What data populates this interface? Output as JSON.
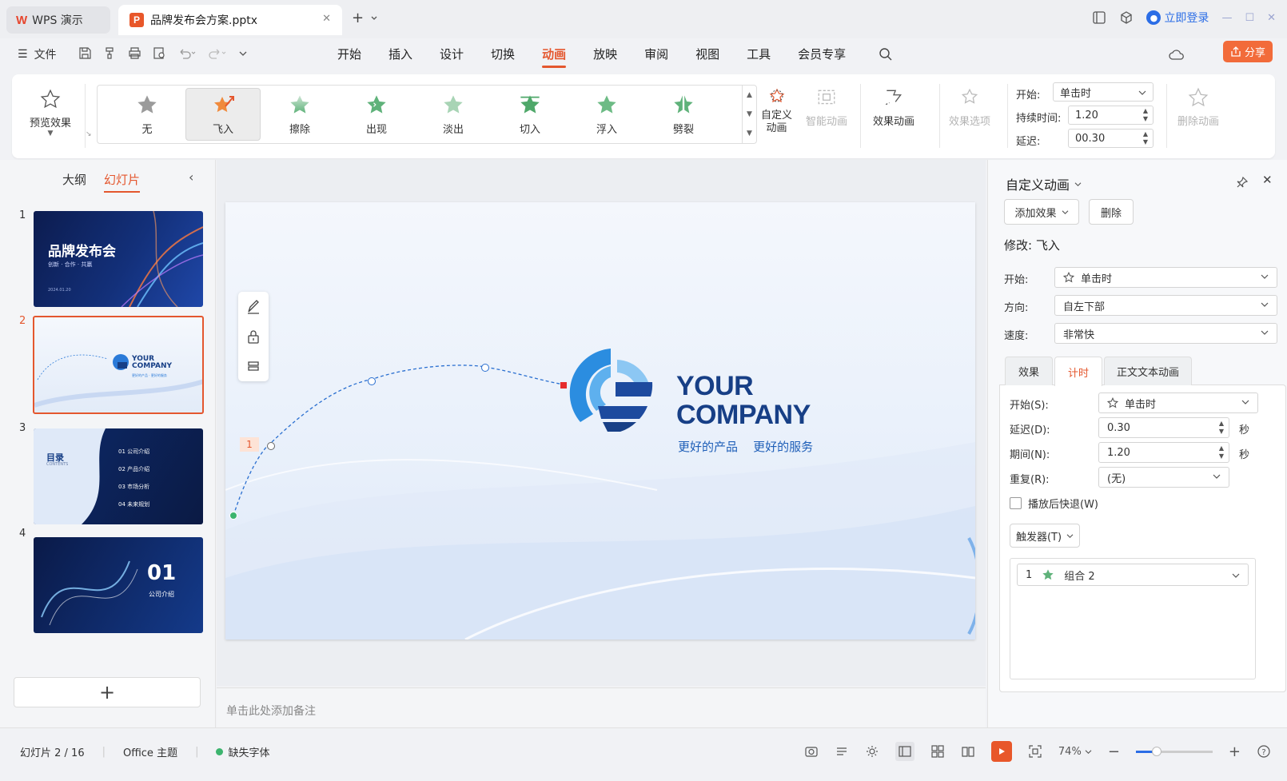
{
  "titlebar": {
    "app_name": "WPS 演示",
    "doc_tab": "品牌发布会方案.pptx",
    "login": "立即登录"
  },
  "menubar": {
    "file": "文件",
    "tabs": [
      "开始",
      "插入",
      "设计",
      "切换",
      "动画",
      "放映",
      "审阅",
      "视图",
      "工具",
      "会员专享"
    ],
    "active_tab": "动画",
    "share": "分享"
  },
  "ribbon": {
    "preview": "预览效果",
    "gallery": [
      "无",
      "飞入",
      "擦除",
      "出现",
      "淡出",
      "切入",
      "浮入",
      "劈裂"
    ],
    "selected_effect": "飞入",
    "custom_anim_line1": "自定义",
    "custom_anim_line2": "动画",
    "smart_anim": "智能动画",
    "path_anim": "效果动画",
    "effect_options": "效果选项",
    "start_label": "开始:",
    "start_value": "单击时",
    "duration_label": "持续时间:",
    "duration_value": "1.20",
    "delay_label": "延迟:",
    "delay_value": "00.30",
    "delete_anim": "删除动画"
  },
  "leftpanel": {
    "tab_outline": "大纲",
    "tab_slides": "幻灯片",
    "active_slide": 2,
    "slides": [
      {
        "num": "1",
        "title": "品牌发布会",
        "sub": "创新 · 合作 · 共赢",
        "date": "2024.01.20"
      },
      {
        "num": "2",
        "title": "YOUR",
        "title2": "COMPANY",
        "sub": "更好的产品 · 更好的服务"
      },
      {
        "num": "3",
        "title": "目录",
        "sub": "CONTENTS",
        "items": [
          "01  公司介绍",
          "02  产品介绍",
          "03  市场分析",
          "04  未来规划"
        ]
      },
      {
        "num": "4",
        "title": "01",
        "sub": "公司介绍"
      }
    ]
  },
  "slide": {
    "company_line1": "YOUR",
    "company_line2": "COMPANY",
    "tagline": "更好的产品    更好的服务",
    "anim_tag": "1"
  },
  "notes_placeholder": "单击此处添加备注",
  "rightpanel": {
    "title": "自定义动画",
    "add_effect": "添加效果",
    "delete": "删除",
    "modify": "修改: 飞入",
    "start_label": "开始:",
    "start_value": "单击时",
    "direction_label": "方向:",
    "direction_value": "自左下部",
    "speed_label": "速度:",
    "speed_value": "非常快",
    "tabs": [
      "效果",
      "计时",
      "正文文本动画"
    ],
    "active_tab": "计时",
    "t_start_label": "开始(S):",
    "t_start_value": "单击时",
    "t_delay_label": "延迟(D):",
    "t_delay_value": "0.30",
    "t_delay_unit": "秒",
    "t_period_label": "期间(N):",
    "t_period_value": "1.20",
    "t_period_unit": "秒",
    "t_repeat_label": "重复(R):",
    "t_repeat_value": "(无)",
    "rewind_label": "播放后快退(W)",
    "trigger": "触发器(T)",
    "list_item_num": "1",
    "list_item_name": "组合 2"
  },
  "statusbar": {
    "slide_pos": "幻灯片 2 / 16",
    "theme": "Office 主题",
    "missing_font": "缺失字体",
    "zoom": "74%"
  },
  "colors": {
    "accent": "#e4572e",
    "brand_blue": "#1e3f8a",
    "star_green": "#5fb27a"
  }
}
